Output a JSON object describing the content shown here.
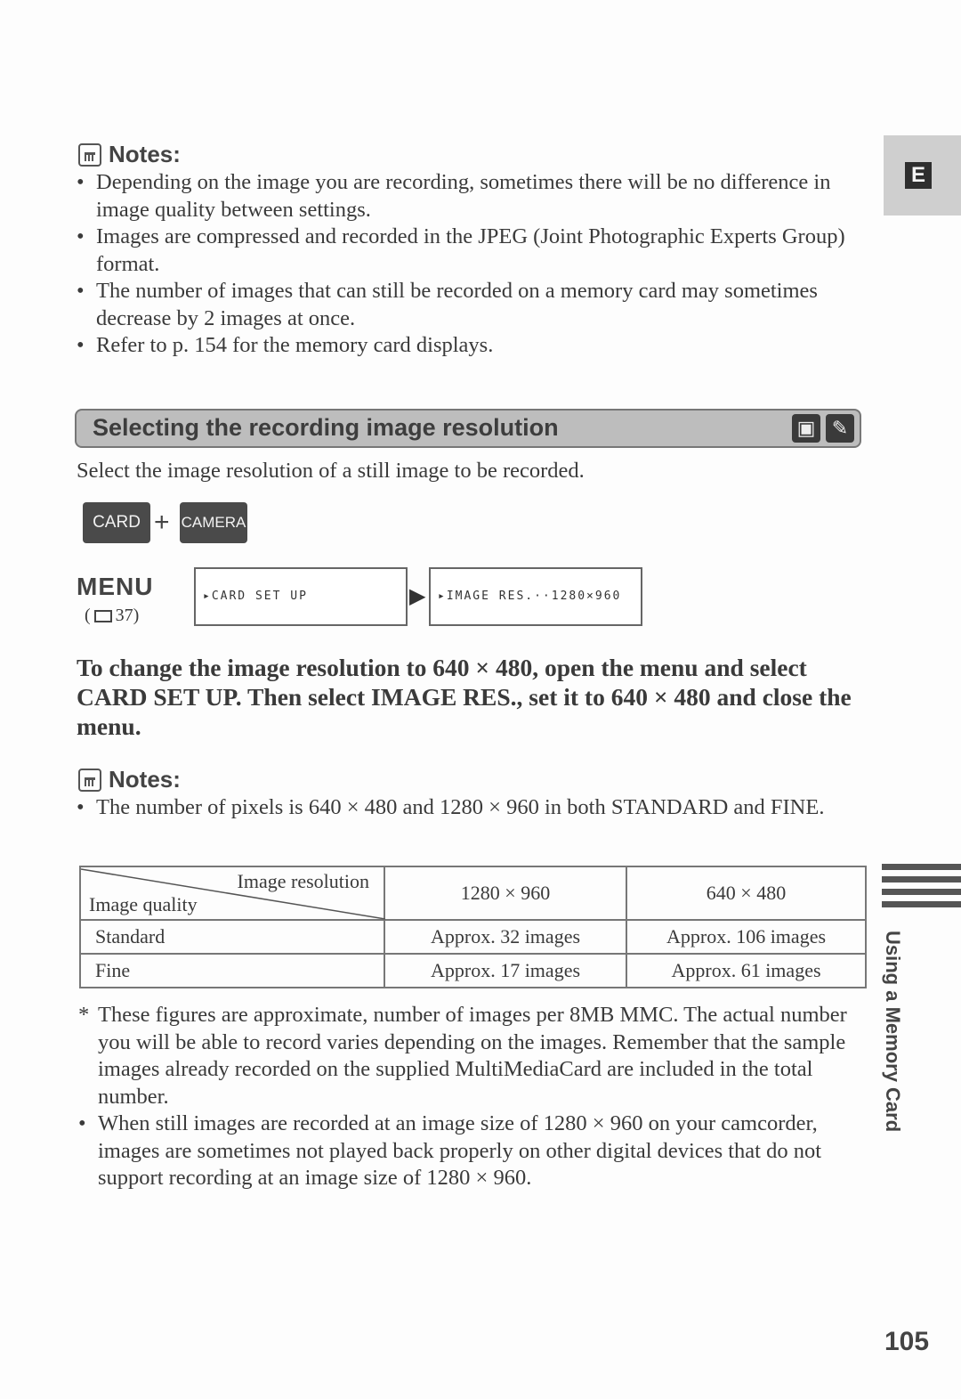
{
  "notes1": {
    "heading": "Notes:",
    "items": [
      "Depending on the image you are recording, sometimes there will be no difference in image quality between settings.",
      "Images are compressed and recorded in the JPEG (Joint Photographic Experts Group) format.",
      "The number of images that can still be recorded on a memory card may sometimes decrease by 2 images at once.",
      "Refer to p. 154 for the memory card displays."
    ]
  },
  "section": {
    "title": "Selecting the recording image resolution",
    "icons": [
      "card-camera-mode-icon",
      "remote-control-icon"
    ]
  },
  "intro": "Select the image resolution of a still image to be recorded.",
  "mode_keys": {
    "card": "CARD",
    "plus": "+",
    "camera": "CAMERA"
  },
  "menu": {
    "label": "MENU",
    "ref": "( 🕮 37)",
    "ref_text": "(",
    "ref_page": "37)",
    "screen1": "▸CARD SET UP",
    "screen2": "▸IMAGE RES.··1280×960"
  },
  "instruction": "To change the image resolution to 640 × 480, open the menu and select CARD SET UP. Then select IMAGE RES., set it to 640 × 480 and close the menu.",
  "notes2": {
    "heading": "Notes:",
    "items": [
      "The number of pixels is 640 × 480 and 1280 × 960 in both STANDARD and FINE."
    ]
  },
  "table": {
    "corner_top": "Image resolution",
    "corner_bottom": "Image quality",
    "columns": [
      "1280 × 960",
      "640 × 480"
    ],
    "rows": [
      {
        "label": "Standard",
        "values": [
          "Approx. 32 images",
          "Approx. 106 images"
        ]
      },
      {
        "label": "Fine",
        "values": [
          "Approx. 17 images",
          "Approx. 61 images"
        ]
      }
    ]
  },
  "footnotes": [
    "These figures are approximate, number of images per 8MB MMC. The actual number you will be able to record varies depending on the images. Remember that the sample images already recorded on the supplied MultiMediaCard are included in the total number.",
    "When still images are recorded at an image size of 1280 × 960 on your camcorder, images are sometimes not played back properly on other digital devices that do not support recording at an image size of 1280 × 960."
  ],
  "side": {
    "language_badge": "E",
    "chapter": "Using a Memory Card"
  },
  "page_number": "105"
}
